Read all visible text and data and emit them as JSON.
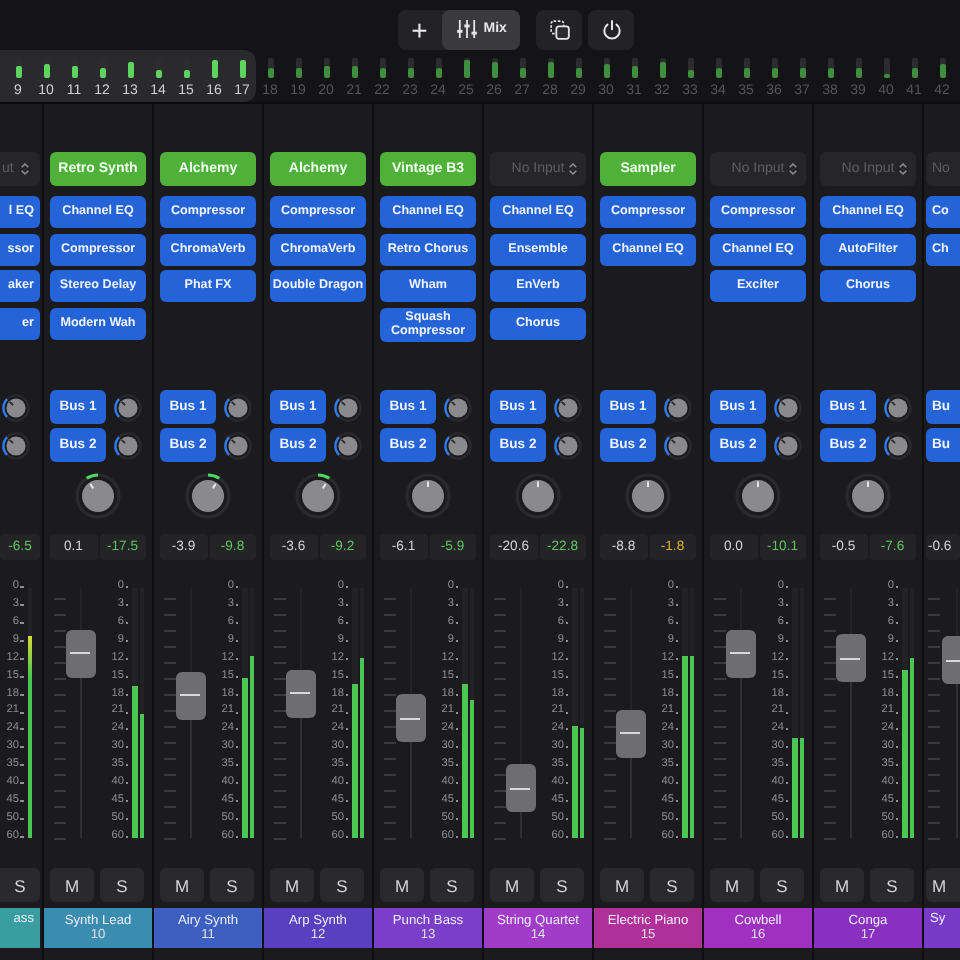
{
  "toolbar": {
    "segments": [
      {
        "kind": "add",
        "label": "+",
        "selected": false
      },
      {
        "kind": "mix",
        "label": "Mix",
        "selected": true
      }
    ],
    "buttons": [
      {
        "kind": "copy"
      },
      {
        "kind": "power"
      }
    ]
  },
  "overview": [
    {
      "number": "9",
      "level": 0.6,
      "in_view": true
    },
    {
      "number": "10",
      "level": 0.7,
      "in_view": true
    },
    {
      "number": "11",
      "level": 0.6,
      "in_view": true
    },
    {
      "number": "12",
      "level": 0.5,
      "in_view": true
    },
    {
      "number": "13",
      "level": 0.8,
      "in_view": true
    },
    {
      "number": "14",
      "level": 0.4,
      "in_view": true
    },
    {
      "number": "15",
      "level": 0.4,
      "in_view": true
    },
    {
      "number": "16",
      "level": 0.9,
      "in_view": true
    },
    {
      "number": "17",
      "level": 0.9,
      "in_view": true
    },
    {
      "number": "18",
      "level": 0.5,
      "in_view": false
    },
    {
      "number": "19",
      "level": 0.5,
      "in_view": false
    },
    {
      "number": "20",
      "level": 0.6,
      "in_view": false
    },
    {
      "number": "21",
      "level": 0.6,
      "in_view": false
    },
    {
      "number": "22",
      "level": 0.5,
      "in_view": false
    },
    {
      "number": "23",
      "level": 0.5,
      "in_view": false
    },
    {
      "number": "24",
      "level": 0.5,
      "in_view": false
    },
    {
      "number": "25",
      "level": 0.9,
      "in_view": false
    },
    {
      "number": "26",
      "level": 0.8,
      "in_view": false
    },
    {
      "number": "27",
      "level": 0.5,
      "in_view": false
    },
    {
      "number": "28",
      "level": 0.8,
      "in_view": false
    },
    {
      "number": "29",
      "level": 0.5,
      "in_view": false
    },
    {
      "number": "30",
      "level": 0.7,
      "in_view": false
    },
    {
      "number": "31",
      "level": 0.6,
      "in_view": false
    },
    {
      "number": "32",
      "level": 0.8,
      "in_view": false
    },
    {
      "number": "33",
      "level": 0.4,
      "in_view": false
    },
    {
      "number": "34",
      "level": 0.5,
      "in_view": false
    },
    {
      "number": "35",
      "level": 0.5,
      "in_view": false
    },
    {
      "number": "36",
      "level": 0.5,
      "in_view": false
    },
    {
      "number": "37",
      "level": 0.5,
      "in_view": false
    },
    {
      "number": "38",
      "level": 0.5,
      "in_view": false
    },
    {
      "number": "39",
      "level": 0.5,
      "in_view": false
    },
    {
      "number": "40",
      "level": 0.2,
      "in_view": false
    },
    {
      "number": "41",
      "level": 0.5,
      "in_view": false
    },
    {
      "number": "42",
      "level": 0.7,
      "in_view": false
    }
  ],
  "strips": [
    {
      "kind": "left_edge",
      "input": {
        "kind": "none",
        "text": "ut"
      },
      "plugins": [
        "l EQ",
        "ssor",
        "aker",
        "er"
      ],
      "sends": [
        {
          "kind": "knob_only"
        },
        {
          "kind": "knob_only"
        }
      ],
      "peak": {
        "text": "-6.5",
        "color": "#5cc85c"
      },
      "scale": [
        "0",
        "3",
        "6",
        "9",
        "12",
        "15",
        "18",
        "21",
        "24",
        "30",
        "35",
        "40",
        "45",
        "50",
        "60"
      ],
      "meter": [
        {
          "level": 0.81
        }
      ],
      "solo": "S",
      "name": "ass",
      "color": "#3a9ea0"
    },
    {
      "kind": "full",
      "input": {
        "kind": "instrument",
        "text": "Retro Synth"
      },
      "plugins": [
        "Channel EQ",
        "Compressor",
        "Stereo Delay",
        "Modern Wah"
      ],
      "sends": [
        {
          "kind": "bus",
          "label": "Bus 1"
        },
        {
          "kind": "bus",
          "label": "Bus 2"
        }
      ],
      "pan": {
        "left": true,
        "right": false
      },
      "volume": "0.1",
      "peak": {
        "text": "-17.5",
        "color": "#5cc85c"
      },
      "scale": [
        "0",
        "3",
        "6",
        "9",
        "12",
        "15",
        "18",
        "21",
        "24",
        "30",
        "35",
        "40",
        "45",
        "50",
        "60"
      ],
      "fader": {
        "level": 0.74
      },
      "meter": [
        {
          "level": 0.61
        },
        {
          "level": 0.5
        }
      ],
      "mute": "M",
      "solo": "S",
      "name": "Synth Lead",
      "number": "10",
      "color": "#3a8db0"
    },
    {
      "kind": "full",
      "input": {
        "kind": "instrument",
        "text": "Alchemy"
      },
      "plugins": [
        "Compressor",
        "ChromaVerb",
        "Phat FX"
      ],
      "sends": [
        {
          "kind": "bus",
          "label": "Bus 1"
        },
        {
          "kind": "bus",
          "label": "Bus 2"
        }
      ],
      "pan": {
        "left": false,
        "right": true
      },
      "volume": "-3.9",
      "peak": {
        "text": "-9.8",
        "color": "#5cc85c"
      },
      "scale": [
        "0",
        "3",
        "6",
        "9",
        "12",
        "15",
        "18",
        "21",
        "24",
        "30",
        "35",
        "40",
        "45",
        "50",
        "60"
      ],
      "fader": {
        "level": 0.57
      },
      "meter": [
        {
          "level": 0.64
        },
        {
          "level": 0.73
        }
      ],
      "mute": "M",
      "solo": "S",
      "name": "Airy Synth",
      "number": "11",
      "color": "#3d60c0"
    },
    {
      "kind": "full",
      "input": {
        "kind": "instrument",
        "text": "Alchemy"
      },
      "plugins": [
        "Compressor",
        "ChromaVerb",
        "Double Dragon"
      ],
      "sends": [
        {
          "kind": "bus",
          "label": "Bus 1"
        },
        {
          "kind": "bus",
          "label": "Bus 2"
        }
      ],
      "pan": {
        "left": false,
        "right": true
      },
      "volume": "-3.6",
      "peak": {
        "text": "-9.2",
        "color": "#5cc85c"
      },
      "scale": [
        "0",
        "3",
        "6",
        "9",
        "12",
        "15",
        "18",
        "21",
        "24",
        "30",
        "35",
        "40",
        "45",
        "50",
        "60"
      ],
      "fader": {
        "level": 0.58
      },
      "meter": [
        {
          "level": 0.62
        },
        {
          "level": 0.72
        }
      ],
      "mute": "M",
      "solo": "S",
      "name": "Arp Synth",
      "number": "12",
      "color": "#5840c0"
    },
    {
      "kind": "full",
      "input": {
        "kind": "instrument",
        "text": "Vintage B3"
      },
      "plugins": [
        "Channel EQ",
        "Retro Chorus",
        "Wham",
        "Squash Compressor"
      ],
      "sends": [
        {
          "kind": "bus",
          "label": "Bus 1"
        },
        {
          "kind": "bus",
          "label": "Bus 2"
        }
      ],
      "pan": {
        "left": false,
        "right": false
      },
      "volume": "-6.1",
      "peak": {
        "text": "-5.9",
        "color": "#5cc85c"
      },
      "scale": [
        "0",
        "3",
        "6",
        "9",
        "12",
        "15",
        "18",
        "21",
        "24",
        "30",
        "35",
        "40",
        "45",
        "50",
        "60"
      ],
      "fader": {
        "level": 0.48
      },
      "meter": [
        {
          "level": 0.62
        },
        {
          "level": 0.55
        }
      ],
      "mute": "M",
      "solo": "S",
      "name": "Punch Bass",
      "number": "13",
      "color": "#7a3ec8"
    },
    {
      "kind": "full",
      "input": {
        "kind": "none",
        "text": "No Input"
      },
      "plugins": [
        "Channel EQ",
        "Ensemble",
        "EnVerb",
        "Chorus"
      ],
      "sends": [
        {
          "kind": "bus",
          "label": "Bus 1"
        },
        {
          "kind": "bus",
          "label": "Bus 2"
        }
      ],
      "pan": {
        "left": false,
        "right": false
      },
      "volume": "-20.6",
      "peak": {
        "text": "-22.8",
        "color": "#5cc85c"
      },
      "scale": [
        "0",
        "3",
        "6",
        "9",
        "12",
        "15",
        "18",
        "21",
        "24",
        "30",
        "35",
        "40",
        "45",
        "50",
        "60"
      ],
      "fader": {
        "level": 0.2
      },
      "meter": [
        {
          "level": 0.45
        },
        {
          "level": 0.44
        }
      ],
      "mute": "M",
      "solo": "S",
      "name": "String Quartet",
      "number": "14",
      "color": "#a03cc8"
    },
    {
      "kind": "full",
      "input": {
        "kind": "instrument",
        "text": "Sampler"
      },
      "plugins": [
        "Compressor",
        "Channel EQ"
      ],
      "sends": [
        {
          "kind": "bus",
          "label": "Bus 1"
        },
        {
          "kind": "bus",
          "label": "Bus 2"
        }
      ],
      "pan": {
        "left": false,
        "right": false
      },
      "volume": "-8.8",
      "peak": {
        "text": "-1.8",
        "color": "#e0b030"
      },
      "scale": [
        "0",
        "3",
        "6",
        "9",
        "12",
        "15",
        "18",
        "21",
        "24",
        "30",
        "35",
        "40",
        "45",
        "50",
        "60"
      ],
      "fader": {
        "level": 0.42
      },
      "meter": [
        {
          "level": 0.73
        },
        {
          "level": 0.73
        }
      ],
      "mute": "M",
      "solo": "S",
      "name": "Electric Piano",
      "number": "15",
      "color": "#b0309a"
    },
    {
      "kind": "full",
      "input": {
        "kind": "none",
        "text": "No Input"
      },
      "plugins": [
        "Compressor",
        "Channel EQ",
        "Exciter"
      ],
      "sends": [
        {
          "kind": "bus",
          "label": "Bus 1"
        },
        {
          "kind": "bus",
          "label": "Bus 2"
        }
      ],
      "pan": {
        "left": false,
        "right": false
      },
      "volume": "0.0",
      "peak": {
        "text": "-10.1",
        "color": "#5cc85c"
      },
      "scale": [
        "0",
        "3",
        "6",
        "9",
        "12",
        "15",
        "18",
        "21",
        "24",
        "30",
        "35",
        "40",
        "45",
        "50",
        "60"
      ],
      "fader": {
        "level": 0.74
      },
      "meter": [
        {
          "level": 0.4
        },
        {
          "level": 0.4
        }
      ],
      "mute": "M",
      "solo": "S",
      "name": "Cowbell",
      "number": "16",
      "color": "#a030bf"
    },
    {
      "kind": "full",
      "input": {
        "kind": "none",
        "text": "No Input"
      },
      "plugins": [
        "Channel EQ",
        "AutoFilter",
        "Chorus"
      ],
      "sends": [
        {
          "kind": "bus",
          "label": "Bus 1"
        },
        {
          "kind": "bus",
          "label": "Bus 2"
        }
      ],
      "pan": {
        "left": false,
        "right": false
      },
      "volume": "-0.5",
      "peak": {
        "text": "-7.6",
        "color": "#5cc85c"
      },
      "scale": [
        "0",
        "3",
        "6",
        "9",
        "12",
        "15",
        "18",
        "21",
        "24",
        "30",
        "35",
        "40",
        "45",
        "50",
        "60"
      ],
      "fader": {
        "level": 0.72
      },
      "meter": [
        {
          "level": 0.67
        },
        {
          "level": 0.72
        }
      ],
      "mute": "M",
      "solo": "S",
      "name": "Conga",
      "number": "17",
      "color": "#8a30c0"
    },
    {
      "kind": "right_edge",
      "input": {
        "kind": "none",
        "text": "No"
      },
      "plugins": [
        "Co",
        "Ch"
      ],
      "sends": [
        {
          "kind": "label_only",
          "label": "Bu"
        },
        {
          "kind": "label_only",
          "label": "Bu"
        }
      ],
      "volume": "-0.6",
      "fader": {
        "level": 0.71
      },
      "mute": "M",
      "name": "Sy",
      "color": "#7a3ac8"
    }
  ]
}
